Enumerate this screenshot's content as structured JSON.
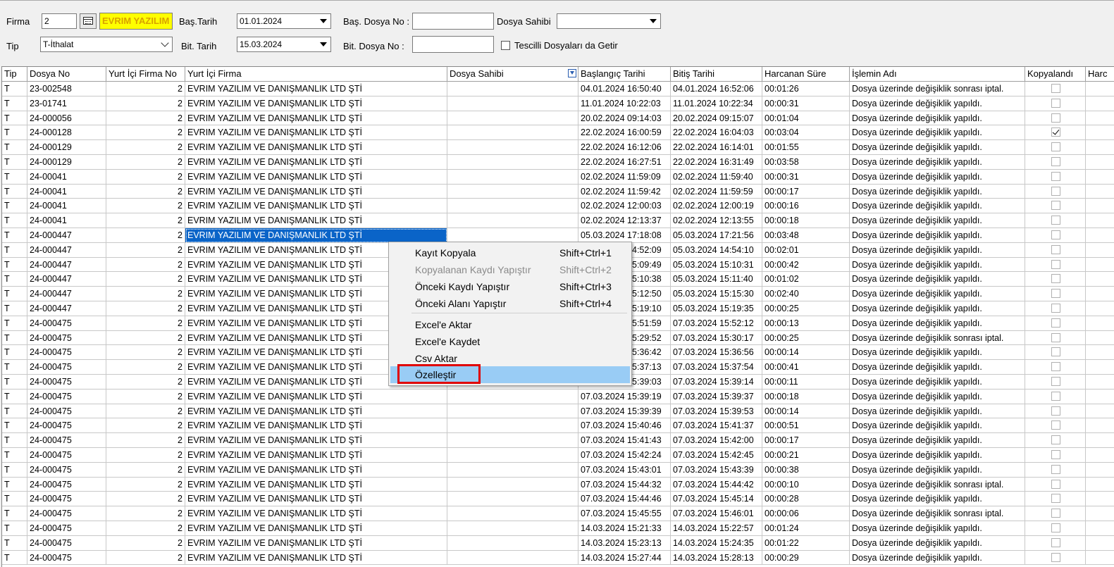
{
  "filters": {
    "firma_label": "Firma",
    "firma_code": "2",
    "firma_name": "EVRIM YAZILIM",
    "tip_label": "Tip",
    "tip_value": "T-İthalat",
    "bas_tarih_label": "Baş.Tarih",
    "bas_tarih_value": "01.01.2024",
    "bit_tarih_label": "Bit. Tarih",
    "bit_tarih_value": "15.03.2024",
    "bas_dosya_label": "Baş. Dosya No :",
    "bas_dosya_value": "",
    "bit_dosya_label": "Bit. Dosya No :",
    "bit_dosya_value": "",
    "dosya_sahibi_label": "Dosya Sahibi",
    "dosya_sahibi_value": "",
    "tescilli_label": "Tescilli Dosyaları da Getir",
    "tescilli_checked": false
  },
  "grid": {
    "columns": [
      "Tip",
      "Dosya No",
      "Yurt İçi Firma No",
      "Yurt İçi Firma",
      "Dosya Sahibi",
      "Başlangıç Tarihi",
      "Bitiş Tarihi",
      "Harcanan Süre",
      "İşlemin Adı",
      "Kopyalandı",
      "Harc"
    ],
    "rows": [
      {
        "tip": "T",
        "dosya": "23-002548",
        "fno": "2",
        "firma": "EVRIM YAZILIM VE DANIŞMANLIK LTD ŞTİ",
        "sahibi": "",
        "bas": "04.01.2024 16:50:40",
        "bit": "04.01.2024 16:52:06",
        "sure": "00:01:26",
        "islem": "Dosya üzerinde değişiklik sonrası iptal.",
        "kop": false
      },
      {
        "tip": "T",
        "dosya": "23-01741",
        "fno": "2",
        "firma": "EVRIM YAZILIM VE DANIŞMANLIK LTD ŞTİ",
        "sahibi": "",
        "bas": "11.01.2024 10:22:03",
        "bit": "11.01.2024 10:22:34",
        "sure": "00:00:31",
        "islem": "Dosya üzerinde değişiklik yapıldı.",
        "kop": false
      },
      {
        "tip": "T",
        "dosya": "24-000056",
        "fno": "2",
        "firma": "EVRIM YAZILIM VE DANIŞMANLIK LTD ŞTİ",
        "sahibi": "",
        "bas": "20.02.2024 09:14:03",
        "bit": "20.02.2024 09:15:07",
        "sure": "00:01:04",
        "islem": "Dosya üzerinde değişiklik yapıldı.",
        "kop": false
      },
      {
        "tip": "T",
        "dosya": "24-000128",
        "fno": "2",
        "firma": "EVRIM YAZILIM VE DANIŞMANLIK LTD ŞTİ",
        "sahibi": "",
        "bas": "22.02.2024 16:00:59",
        "bit": "22.02.2024 16:04:03",
        "sure": "00:03:04",
        "islem": "Dosya üzerinde değişiklik yapıldı.",
        "kop": true
      },
      {
        "tip": "T",
        "dosya": "24-000129",
        "fno": "2",
        "firma": "EVRIM YAZILIM VE DANIŞMANLIK LTD ŞTİ",
        "sahibi": "",
        "bas": "22.02.2024 16:12:06",
        "bit": "22.02.2024 16:14:01",
        "sure": "00:01:55",
        "islem": "Dosya üzerinde değişiklik yapıldı.",
        "kop": false
      },
      {
        "tip": "T",
        "dosya": "24-000129",
        "fno": "2",
        "firma": "EVRIM YAZILIM VE DANIŞMANLIK LTD ŞTİ",
        "sahibi": "",
        "bas": "22.02.2024 16:27:51",
        "bit": "22.02.2024 16:31:49",
        "sure": "00:03:58",
        "islem": "Dosya üzerinde değişiklik yapıldı.",
        "kop": false
      },
      {
        "tip": "T",
        "dosya": "24-00041",
        "fno": "2",
        "firma": "EVRIM YAZILIM VE DANIŞMANLIK LTD ŞTİ",
        "sahibi": "",
        "bas": "02.02.2024 11:59:09",
        "bit": "02.02.2024 11:59:40",
        "sure": "00:00:31",
        "islem": "Dosya üzerinde değişiklik yapıldı.",
        "kop": false
      },
      {
        "tip": "T",
        "dosya": "24-00041",
        "fno": "2",
        "firma": "EVRIM YAZILIM VE DANIŞMANLIK LTD ŞTİ",
        "sahibi": "",
        "bas": "02.02.2024 11:59:42",
        "bit": "02.02.2024 11:59:59",
        "sure": "00:00:17",
        "islem": "Dosya üzerinde değişiklik yapıldı.",
        "kop": false
      },
      {
        "tip": "T",
        "dosya": "24-00041",
        "fno": "2",
        "firma": "EVRIM YAZILIM VE DANIŞMANLIK LTD ŞTİ",
        "sahibi": "",
        "bas": "02.02.2024 12:00:03",
        "bit": "02.02.2024 12:00:19",
        "sure": "00:00:16",
        "islem": "Dosya üzerinde değişiklik yapıldı.",
        "kop": false
      },
      {
        "tip": "T",
        "dosya": "24-00041",
        "fno": "2",
        "firma": "EVRIM YAZILIM VE DANIŞMANLIK LTD ŞTİ",
        "sahibi": "",
        "bas": "02.02.2024 12:13:37",
        "bit": "02.02.2024 12:13:55",
        "sure": "00:00:18",
        "islem": "Dosya üzerinde değişiklik yapıldı.",
        "kop": false
      },
      {
        "tip": "T",
        "dosya": "24-000447",
        "fno": "2",
        "firma": "EVRIM YAZILIM VE DANIŞMANLIK LTD ŞTİ",
        "sahibi": "",
        "bas": "05.03.2024 17:18:08",
        "bit": "05.03.2024 17:21:56",
        "sure": "00:03:48",
        "islem": "Dosya üzerinde değişiklik yapıldı.",
        "kop": false,
        "selected": true
      },
      {
        "tip": "T",
        "dosya": "24-000447",
        "fno": "2",
        "firma": "EVRIM YAZILIM VE DANIŞMANLIK LTD ŞTİ",
        "sahibi": "",
        "bas": "05.03.2024 14:52:09",
        "bit": "05.03.2024 14:54:10",
        "sure": "00:02:01",
        "islem": "Dosya üzerinde değişiklik yapıldı.",
        "kop": false
      },
      {
        "tip": "T",
        "dosya": "24-000447",
        "fno": "2",
        "firma": "EVRIM YAZILIM VE DANIŞMANLIK LTD ŞTİ",
        "sahibi": "",
        "bas": "05.03.2024 15:09:49",
        "bit": "05.03.2024 15:10:31",
        "sure": "00:00:42",
        "islem": "Dosya üzerinde değişiklik yapıldı.",
        "kop": false
      },
      {
        "tip": "T",
        "dosya": "24-000447",
        "fno": "2",
        "firma": "EVRIM YAZILIM VE DANIŞMANLIK LTD ŞTİ",
        "sahibi": "",
        "bas": "05.03.2024 15:10:38",
        "bit": "05.03.2024 15:11:40",
        "sure": "00:01:02",
        "islem": "Dosya üzerinde değişiklik yapıldı.",
        "kop": false
      },
      {
        "tip": "T",
        "dosya": "24-000447",
        "fno": "2",
        "firma": "EVRIM YAZILIM VE DANIŞMANLIK LTD ŞTİ",
        "sahibi": "",
        "bas": "05.03.2024 15:12:50",
        "bit": "05.03.2024 15:15:30",
        "sure": "00:02:40",
        "islem": "Dosya üzerinde değişiklik yapıldı.",
        "kop": false
      },
      {
        "tip": "T",
        "dosya": "24-000447",
        "fno": "2",
        "firma": "EVRIM YAZILIM VE DANIŞMANLIK LTD ŞTİ",
        "sahibi": "",
        "bas": "05.03.2024 15:19:10",
        "bit": "05.03.2024 15:19:35",
        "sure": "00:00:25",
        "islem": "Dosya üzerinde değişiklik yapıldı.",
        "kop": false
      },
      {
        "tip": "T",
        "dosya": "24-000475",
        "fno": "2",
        "firma": "EVRIM YAZILIM VE DANIŞMANLIK LTD ŞTİ",
        "sahibi": "",
        "bas": "07.03.2024 15:51:59",
        "bit": "07.03.2024 15:52:12",
        "sure": "00:00:13",
        "islem": "Dosya üzerinde değişiklik yapıldı.",
        "kop": false
      },
      {
        "tip": "T",
        "dosya": "24-000475",
        "fno": "2",
        "firma": "EVRIM YAZILIM VE DANIŞMANLIK LTD ŞTİ",
        "sahibi": "",
        "bas": "07.03.2024 15:29:52",
        "bit": "07.03.2024 15:30:17",
        "sure": "00:00:25",
        "islem": "Dosya üzerinde değişiklik sonrası iptal.",
        "kop": false
      },
      {
        "tip": "T",
        "dosya": "24-000475",
        "fno": "2",
        "firma": "EVRIM YAZILIM VE DANIŞMANLIK LTD ŞTİ",
        "sahibi": "",
        "bas": "07.03.2024 15:36:42",
        "bit": "07.03.2024 15:36:56",
        "sure": "00:00:14",
        "islem": "Dosya üzerinde değişiklik yapıldı.",
        "kop": false
      },
      {
        "tip": "T",
        "dosya": "24-000475",
        "fno": "2",
        "firma": "EVRIM YAZILIM VE DANIŞMANLIK LTD ŞTİ",
        "sahibi": "",
        "bas": "07.03.2024 15:37:13",
        "bit": "07.03.2024 15:37:54",
        "sure": "00:00:41",
        "islem": "Dosya üzerinde değişiklik yapıldı.",
        "kop": false
      },
      {
        "tip": "T",
        "dosya": "24-000475",
        "fno": "2",
        "firma": "EVRIM YAZILIM VE DANIŞMANLIK LTD ŞTİ",
        "sahibi": "",
        "bas": "07.03.2024 15:39:03",
        "bit": "07.03.2024 15:39:14",
        "sure": "00:00:11",
        "islem": "Dosya üzerinde değişiklik yapıldı.",
        "kop": false
      },
      {
        "tip": "T",
        "dosya": "24-000475",
        "fno": "2",
        "firma": "EVRIM YAZILIM VE DANIŞMANLIK LTD ŞTİ",
        "sahibi": "",
        "bas": "07.03.2024 15:39:19",
        "bit": "07.03.2024 15:39:37",
        "sure": "00:00:18",
        "islem": "Dosya üzerinde değişiklik yapıldı.",
        "kop": false
      },
      {
        "tip": "T",
        "dosya": "24-000475",
        "fno": "2",
        "firma": "EVRIM YAZILIM VE DANIŞMANLIK LTD ŞTİ",
        "sahibi": "",
        "bas": "07.03.2024 15:39:39",
        "bit": "07.03.2024 15:39:53",
        "sure": "00:00:14",
        "islem": "Dosya üzerinde değişiklik yapıldı.",
        "kop": false
      },
      {
        "tip": "T",
        "dosya": "24-000475",
        "fno": "2",
        "firma": "EVRIM YAZILIM VE DANIŞMANLIK LTD ŞTİ",
        "sahibi": "",
        "bas": "07.03.2024 15:40:46",
        "bit": "07.03.2024 15:41:37",
        "sure": "00:00:51",
        "islem": "Dosya üzerinde değişiklik yapıldı.",
        "kop": false
      },
      {
        "tip": "T",
        "dosya": "24-000475",
        "fno": "2",
        "firma": "EVRIM YAZILIM VE DANIŞMANLIK LTD ŞTİ",
        "sahibi": "",
        "bas": "07.03.2024 15:41:43",
        "bit": "07.03.2024 15:42:00",
        "sure": "00:00:17",
        "islem": "Dosya üzerinde değişiklik yapıldı.",
        "kop": false
      },
      {
        "tip": "T",
        "dosya": "24-000475",
        "fno": "2",
        "firma": "EVRIM YAZILIM VE DANIŞMANLIK LTD ŞTİ",
        "sahibi": "",
        "bas": "07.03.2024 15:42:24",
        "bit": "07.03.2024 15:42:45",
        "sure": "00:00:21",
        "islem": "Dosya üzerinde değişiklik yapıldı.",
        "kop": false
      },
      {
        "tip": "T",
        "dosya": "24-000475",
        "fno": "2",
        "firma": "EVRIM YAZILIM VE DANIŞMANLIK LTD ŞTİ",
        "sahibi": "",
        "bas": "07.03.2024 15:43:01",
        "bit": "07.03.2024 15:43:39",
        "sure": "00:00:38",
        "islem": "Dosya üzerinde değişiklik yapıldı.",
        "kop": false
      },
      {
        "tip": "T",
        "dosya": "24-000475",
        "fno": "2",
        "firma": "EVRIM YAZILIM VE DANIŞMANLIK LTD ŞTİ",
        "sahibi": "",
        "bas": "07.03.2024 15:44:32",
        "bit": "07.03.2024 15:44:42",
        "sure": "00:00:10",
        "islem": "Dosya üzerinde değişiklik sonrası iptal.",
        "kop": false
      },
      {
        "tip": "T",
        "dosya": "24-000475",
        "fno": "2",
        "firma": "EVRIM YAZILIM VE DANIŞMANLIK LTD ŞTİ",
        "sahibi": "",
        "bas": "07.03.2024 15:44:46",
        "bit": "07.03.2024 15:45:14",
        "sure": "00:00:28",
        "islem": "Dosya üzerinde değişiklik yapıldı.",
        "kop": false
      },
      {
        "tip": "T",
        "dosya": "24-000475",
        "fno": "2",
        "firma": "EVRIM YAZILIM VE DANIŞMANLIK LTD ŞTİ",
        "sahibi": "",
        "bas": "07.03.2024 15:45:55",
        "bit": "07.03.2024 15:46:01",
        "sure": "00:00:06",
        "islem": "Dosya üzerinde değişiklik sonrası iptal.",
        "kop": false
      },
      {
        "tip": "T",
        "dosya": "24-000475",
        "fno": "2",
        "firma": "EVRIM YAZILIM VE DANIŞMANLIK LTD ŞTİ",
        "sahibi": "",
        "bas": "14.03.2024 15:21:33",
        "bit": "14.03.2024 15:22:57",
        "sure": "00:01:24",
        "islem": "Dosya üzerinde değişiklik yapıldı.",
        "kop": false
      },
      {
        "tip": "T",
        "dosya": "24-000475",
        "fno": "2",
        "firma": "EVRIM YAZILIM VE DANIŞMANLIK LTD ŞTİ",
        "sahibi": "",
        "bas": "14.03.2024 15:23:13",
        "bit": "14.03.2024 15:24:35",
        "sure": "00:01:22",
        "islem": "Dosya üzerinde değişiklik yapıldı.",
        "kop": false
      },
      {
        "tip": "T",
        "dosya": "24-000475",
        "fno": "2",
        "firma": "EVRIM YAZILIM VE DANIŞMANLIK LTD ŞTİ",
        "sahibi": "",
        "bas": "14.03.2024 15:27:44",
        "bit": "14.03.2024 15:28:13",
        "sure": "00:00:29",
        "islem": "Dosya üzerinde değişiklik yapıldı.",
        "kop": false
      }
    ]
  },
  "context_menu": {
    "items": [
      {
        "label": "Kayıt Kopyala",
        "shortcut": "Shift+Ctrl+1",
        "disabled": false
      },
      {
        "label": "Kopyalanan Kaydı Yapıştır",
        "shortcut": "Shift+Ctrl+2",
        "disabled": true
      },
      {
        "label": "Önceki Kaydı Yapıştır",
        "shortcut": "Shift+Ctrl+3",
        "disabled": false
      },
      {
        "label": "Önceki Alanı Yapıştır",
        "shortcut": "Shift+Ctrl+4",
        "disabled": false
      },
      {
        "label": "Excel'e Aktar",
        "shortcut": "",
        "disabled": false
      },
      {
        "label": "Excel'e Kaydet",
        "shortcut": "",
        "disabled": false
      },
      {
        "label": "Csv Aktar",
        "shortcut": "",
        "disabled": false
      },
      {
        "label": "Özelleştir",
        "shortcut": "",
        "disabled": false,
        "highlighted": true
      }
    ]
  },
  "colors": {
    "selection": "#0a64c8",
    "menu_highlight": "#99ccf5",
    "annotation": "#e00000",
    "firm_name_bg": "#ffff00"
  }
}
